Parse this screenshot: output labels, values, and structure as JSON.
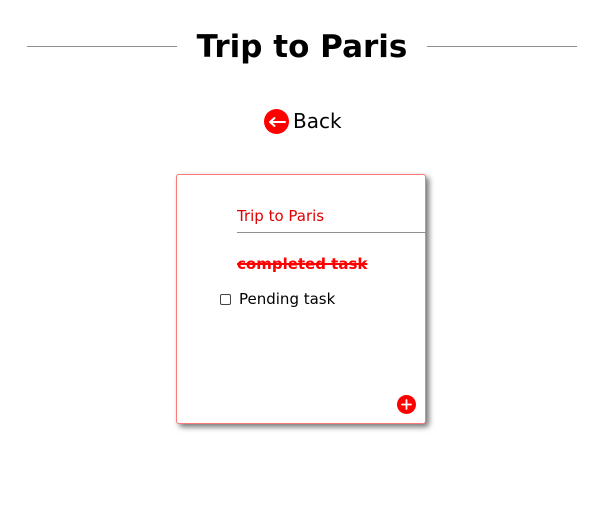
{
  "header": {
    "title": "Trip to Paris"
  },
  "navigation": {
    "back_label": "Back",
    "back_icon": "arrow-left-icon"
  },
  "note": {
    "title": "Trip to Paris",
    "tasks": [
      {
        "label": "completed task",
        "completed": true
      },
      {
        "label": "Pending task",
        "completed": false
      }
    ],
    "add_icon": "plus-icon"
  },
  "colors": {
    "accent": "#ff0000",
    "card_border": "#ff7777",
    "text": "#000000",
    "divider": "#8f8f8f"
  }
}
